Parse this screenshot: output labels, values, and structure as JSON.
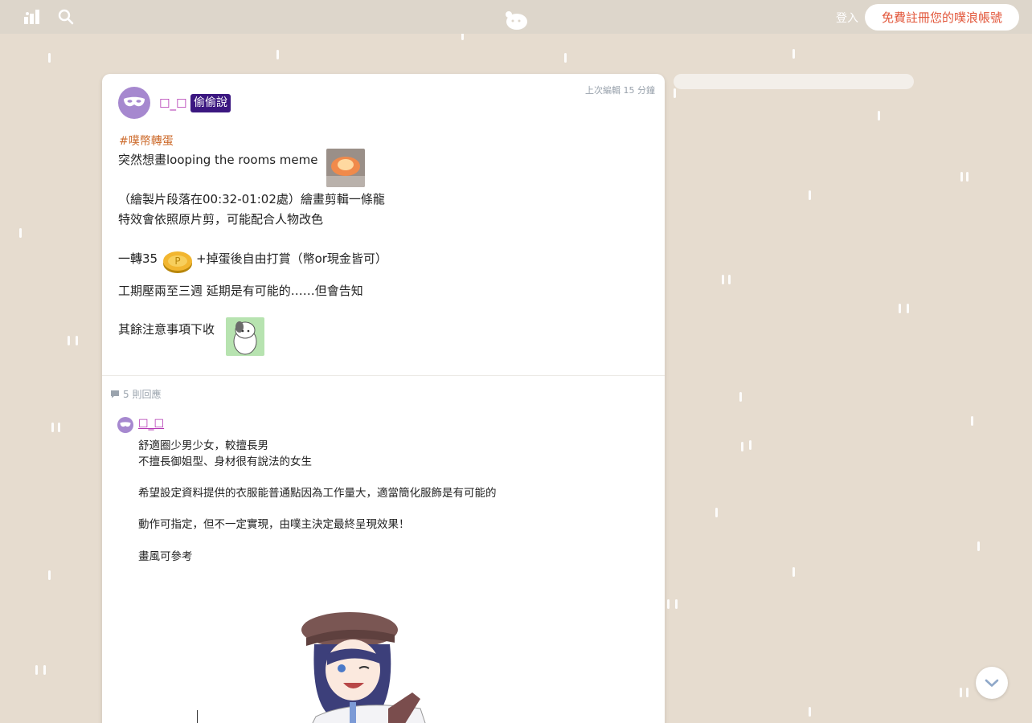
{
  "header": {
    "login_label": "登入",
    "signup_label": "免費註冊您的噗浪帳號",
    "icons": [
      "timeline-icon",
      "search-icon",
      "plurk-logo-icon"
    ]
  },
  "post": {
    "author": "☐_☐",
    "secret_badge": "偷偷說",
    "edited": "上次編輯 15 分鐘",
    "hashtag": "#噗幣轉蛋",
    "lines": [
      "突然想畫looping the rooms meme",
      "（繪製片段落在00:32-01:02處）繪畫剪輯一條龍",
      "特效會依照原片剪，可能配合人物改色",
      "一轉35",
      "+掉蛋後自由打賞（幣or現金皆可）",
      "工期壓兩至三週 延期是有可能的……但會告知",
      "其餘注意事項下收"
    ]
  },
  "responses": {
    "count_label": "5 則回應",
    "first": {
      "author": "☐_☐",
      "lines": [
        "舒適圈少男少女，較擅長男",
        "不擅長御姐型、身材很有說法的女生",
        "希望設定資料提供的衣服能普通點因為工作量大，適當簡化服飾是有可能的",
        "動作可指定，但不一定實現，由噗主決定最終呈現效果！",
        "畫風可參考"
      ]
    }
  },
  "colors": {
    "background": "#e6dccf",
    "topbar": "#ddd6cb",
    "author": "#b235b2",
    "hashtag": "#cd6b2c",
    "secret_badge": "#3b1780",
    "signup_text": "#e2563a"
  }
}
